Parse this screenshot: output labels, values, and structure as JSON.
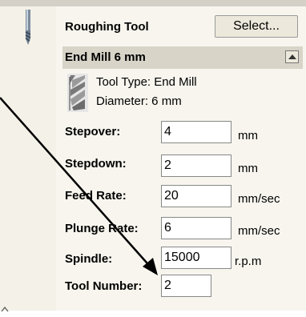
{
  "tool": {
    "section_title": "Roughing Tool",
    "select_label": "Select...",
    "name": "End Mill 6 mm",
    "type_line": "Tool Type: End Mill",
    "diameter_line": "Diameter: 6 mm"
  },
  "fields": {
    "stepover": {
      "label": "Stepover:",
      "value": "4",
      "unit": "mm"
    },
    "stepdown": {
      "label": "Stepdown:",
      "value": "2",
      "unit": "mm"
    },
    "feed_rate": {
      "label": "Feed Rate:",
      "value": "20",
      "unit": "mm/sec"
    },
    "plunge_rate": {
      "label": "Plunge Rate:",
      "value": "6",
      "unit": "mm/sec"
    },
    "spindle": {
      "label": "Spindle:",
      "value": "15000",
      "unit": "r.p.m"
    },
    "tool_number": {
      "label": "Tool Number:",
      "value": "2"
    }
  },
  "icons": {
    "drill": "drill-bit-icon",
    "end_mill": "end-mill-icon",
    "collapse": "scroll-up-icon"
  }
}
